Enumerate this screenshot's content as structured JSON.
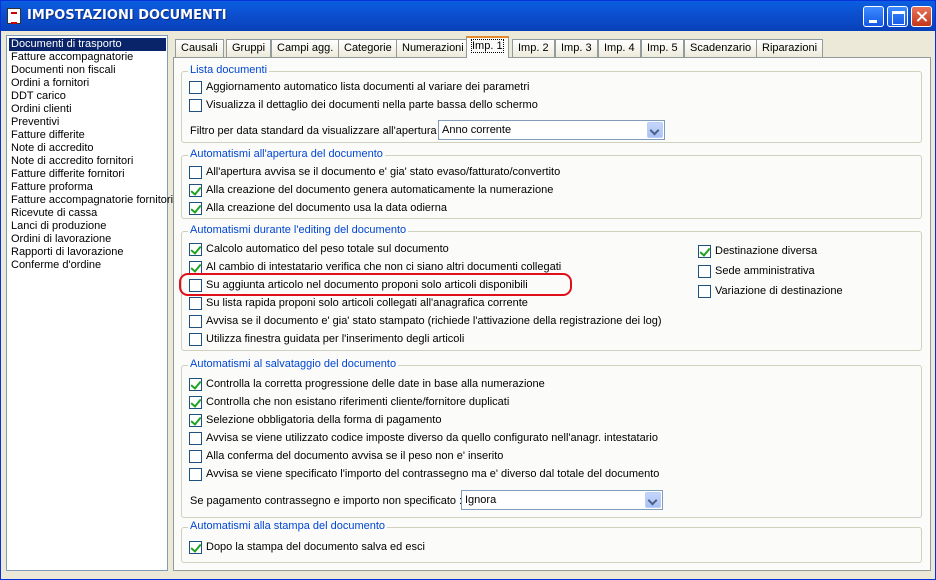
{
  "window": {
    "title": "IMPOSTAZIONI DOCUMENTI"
  },
  "doc_types": [
    "Documenti di trasporto",
    "Fatture accompagnatorie",
    "Documenti non fiscali",
    "Ordini a fornitori",
    "DDT carico",
    "Ordini clienti",
    "Preventivi",
    "Fatture differite",
    "Note di accredito",
    "Note di accredito fornitori",
    "Fatture differite fornitori",
    "Fatture proforma",
    "Fatture accompagnatorie fornitori",
    "Ricevute di cassa",
    "Lanci di produzione",
    "Ordini di lavorazione",
    "Rapporti di lavorazione",
    "Conferme d'ordine"
  ],
  "selected_doc_type": "Documenti di trasporto",
  "tabs": [
    "Causali",
    "Gruppi",
    "Campi agg.",
    "Categorie",
    "Numerazioni",
    "Imp. 1",
    "Imp. 2",
    "Imp. 3",
    "Imp. 4",
    "Imp. 5",
    "Scadenzario",
    "Riparazioni"
  ],
  "active_tab": "Imp. 1",
  "groups": {
    "lista_documenti": {
      "title": "Lista documenti",
      "options": [
        {
          "label": "Aggiornamento automatico lista documenti al variare dei parametri",
          "checked": false
        },
        {
          "label": "Visualizza il dettaglio dei documenti nella parte bassa dello schermo",
          "checked": false
        }
      ],
      "filter_label": "Filtro per data standard da visualizzare all'apertura :",
      "filter_value": "Anno corrente"
    },
    "apertura": {
      "title": "Automatismi all'apertura del documento",
      "options": [
        {
          "label": "All'apertura avvisa se il documento e' gia' stato evaso/fatturato/convertito",
          "checked": false
        },
        {
          "label": "Alla creazione del documento genera automaticamente la numerazione",
          "checked": true
        },
        {
          "label": "Alla creazione del documento usa la data odierna",
          "checked": true
        }
      ]
    },
    "editing": {
      "title": "Automatismi durante l'editing del documento",
      "options": [
        {
          "label": "Calcolo automatico del peso totale sul documento",
          "checked": true
        },
        {
          "label": "Al cambio di intestatario verifica che non ci siano altri documenti collegati",
          "checked": true
        },
        {
          "label": "Su aggiunta articolo nel documento proponi solo articoli disponibili",
          "checked": false
        },
        {
          "label": "Su lista rapida proponi solo articoli collegati all'anagrafica corrente",
          "checked": false
        },
        {
          "label": "Avvisa se il documento e' gia' stato stampato (richiede l'attivazione della registrazione dei log)",
          "checked": false
        },
        {
          "label": "Utilizza finestra guidata per l'inserimento degli articoli",
          "checked": false
        }
      ],
      "right_options": [
        {
          "label": "Destinazione diversa",
          "checked": true
        },
        {
          "label": "Sede amministrativa",
          "checked": false
        },
        {
          "label": "Variazione di destinazione",
          "checked": false
        }
      ]
    },
    "salvataggio": {
      "title": "Automatismi al salvataggio del documento",
      "options": [
        {
          "label": "Controlla la corretta progressione delle date in base alla numerazione",
          "checked": true
        },
        {
          "label": "Controlla che non esistano riferimenti cliente/fornitore duplicati",
          "checked": true
        },
        {
          "label": "Selezione obbligatoria della forma di pagamento",
          "checked": true
        },
        {
          "label": "Avvisa se viene utilizzato codice imposte diverso da quello configurato nell'anagr. intestatario",
          "checked": false
        },
        {
          "label": "Alla conferma del documento avvisa se il peso non e' inserito",
          "checked": false
        },
        {
          "label": "Avvisa se viene specificato l'importo del contrassegno ma e' diverso dal totale del documento",
          "checked": false
        }
      ],
      "payment_label": "Se pagamento contrassegno e importo non specificato :",
      "payment_value": "Ignora"
    },
    "stampa": {
      "title": "Automatismi alla stampa del documento",
      "options": [
        {
          "label": "Dopo la stampa del documento salva ed esci",
          "checked": true
        }
      ]
    }
  }
}
